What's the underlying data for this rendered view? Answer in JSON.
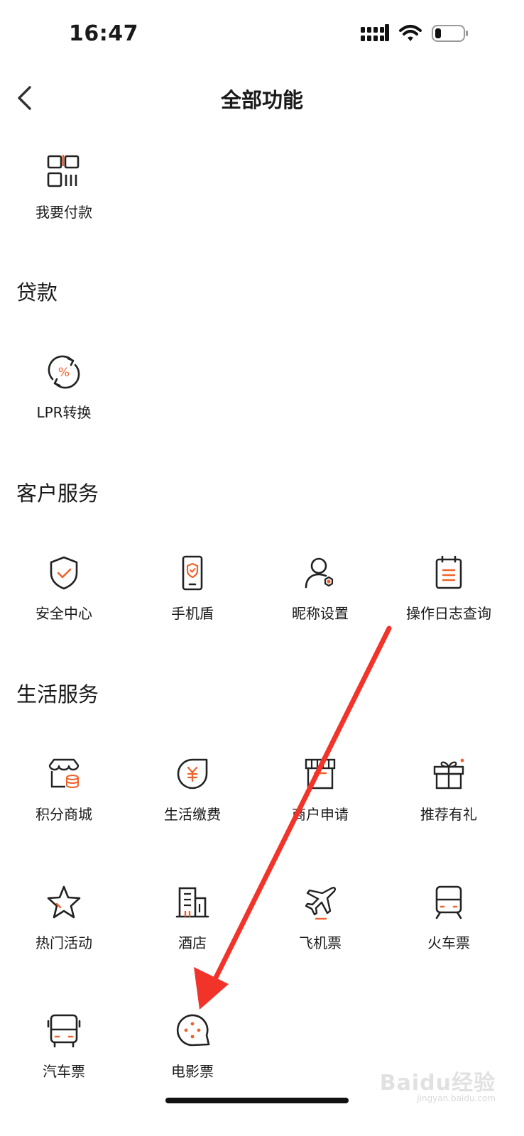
{
  "status_bar": {
    "time": "16:47"
  },
  "header": {
    "title": "全部功能"
  },
  "top_items": [
    {
      "label": "我要付款",
      "icon": "qr-payment-icon"
    }
  ],
  "sections": [
    {
      "title": "贷款",
      "items": [
        {
          "label": "LPR转换",
          "icon": "percent-exchange-icon"
        }
      ]
    },
    {
      "title": "客户服务",
      "items": [
        {
          "label": "安全中心",
          "icon": "shield-check-icon"
        },
        {
          "label": "手机盾",
          "icon": "phone-shield-icon"
        },
        {
          "label": "昵称设置",
          "icon": "user-settings-icon"
        },
        {
          "label": "操作日志查询",
          "icon": "log-calendar-icon"
        }
      ]
    },
    {
      "title": "生活服务",
      "items": [
        {
          "label": "积分商城",
          "icon": "points-mall-icon"
        },
        {
          "label": "生活缴费",
          "icon": "yuan-bill-icon"
        },
        {
          "label": "商户申请",
          "icon": "storefront-icon"
        },
        {
          "label": "推荐有礼",
          "icon": "gift-icon"
        },
        {
          "label": "热门活动",
          "icon": "star-icon"
        },
        {
          "label": "酒店",
          "icon": "hotel-building-icon"
        },
        {
          "label": "飞机票",
          "icon": "airplane-icon"
        },
        {
          "label": "火车票",
          "icon": "train-icon"
        },
        {
          "label": "汽车票",
          "icon": "bus-icon"
        },
        {
          "label": "电影票",
          "icon": "movie-film-icon"
        }
      ]
    }
  ],
  "watermark": {
    "text": "Baidu经验",
    "sub": "jingyan.baidu.com"
  },
  "colors": {
    "accent": "#f0622b",
    "text": "#1a1a1a",
    "annotation_arrow": "#f2332a"
  }
}
